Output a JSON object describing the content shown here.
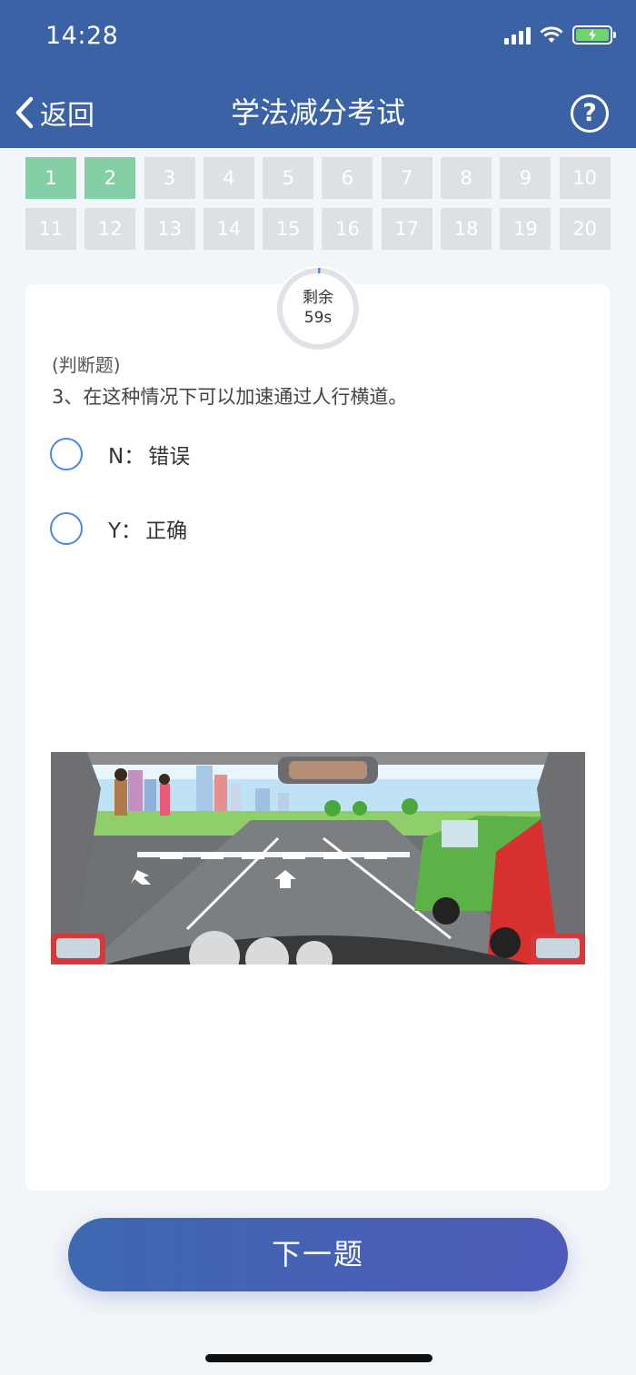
{
  "status": {
    "time": "14:28"
  },
  "nav": {
    "back_label": "返回",
    "title": "学法减分考试",
    "help_symbol": "?"
  },
  "questions": [
    {
      "n": "1",
      "done": true
    },
    {
      "n": "2",
      "done": true
    },
    {
      "n": "3",
      "done": false
    },
    {
      "n": "4",
      "done": false
    },
    {
      "n": "5",
      "done": false
    },
    {
      "n": "6",
      "done": false
    },
    {
      "n": "7",
      "done": false
    },
    {
      "n": "8",
      "done": false
    },
    {
      "n": "9",
      "done": false
    },
    {
      "n": "10",
      "done": false
    },
    {
      "n": "11",
      "done": false
    },
    {
      "n": "12",
      "done": false
    },
    {
      "n": "13",
      "done": false
    },
    {
      "n": "14",
      "done": false
    },
    {
      "n": "15",
      "done": false
    },
    {
      "n": "16",
      "done": false
    },
    {
      "n": "17",
      "done": false
    },
    {
      "n": "18",
      "done": false
    },
    {
      "n": "19",
      "done": false
    },
    {
      "n": "20",
      "done": false
    }
  ],
  "timer": {
    "label": "剩余",
    "value": "59s"
  },
  "question": {
    "type": "(判断题)",
    "text": "3、在这种情况下可以加速通过人行横道。",
    "options": [
      {
        "key": "N：",
        "label": "错误"
      },
      {
        "key": "Y：",
        "label": "正确"
      }
    ]
  },
  "next_button": "下一题",
  "colors": {
    "header": "#3a62a4",
    "done": "#84cfa6",
    "pending": "#dde1e5",
    "accent": "#4a86e8"
  }
}
